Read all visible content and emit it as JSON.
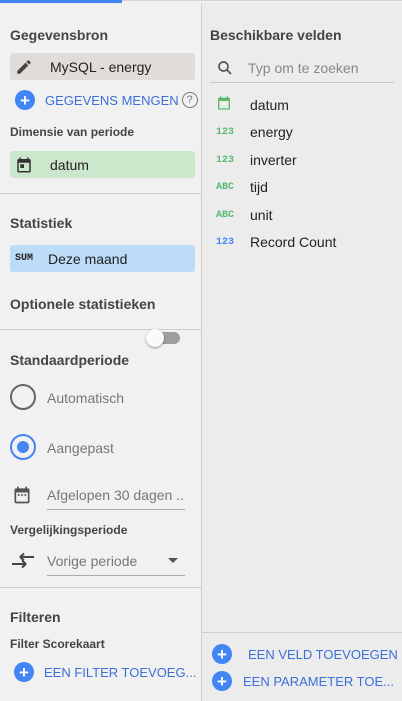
{
  "left": {
    "data_source_title": "Gegevensbron",
    "data_source_value": "MySQL - energy",
    "blend_label": "GEGEVENS MENGEN",
    "period_dimension_title": "Dimensie van periode",
    "period_dimension_value": "datum",
    "metrics_title": "Statistiek",
    "metric_agg": "SUM",
    "metric_value": "Deze maand",
    "optional_metrics_title": "Optionele statistieken",
    "optional_metrics_enabled": false,
    "default_period_title": "Standaardperiode",
    "radio_auto": "Automatisch",
    "radio_custom": "Aangepast",
    "selected_radio": "Aangepast",
    "date_range_value": "Afgelopen 30 dagen ...",
    "comparison_title": "Vergelijkingsperiode",
    "comparison_value": "Vorige periode",
    "filter_title": "Filteren",
    "filter_sub_title": "Filter Scorekaart",
    "add_filter_label": "EEN FILTER TOEVOEG..."
  },
  "right": {
    "fields_title": "Beschikbare velden",
    "search_placeholder": "Typ om te zoeken",
    "fields": [
      {
        "type": "date",
        "badge": "",
        "name": "datum",
        "color": "#5bb974"
      },
      {
        "type": "number",
        "badge": "123",
        "name": "energy",
        "color": "#5bb974"
      },
      {
        "type": "number",
        "badge": "123",
        "name": "inverter",
        "color": "#5bb974"
      },
      {
        "type": "text",
        "badge": "ABC",
        "name": "tijd",
        "color": "#5bb974"
      },
      {
        "type": "text",
        "badge": "ABC",
        "name": "unit",
        "color": "#5bb974"
      },
      {
        "type": "number",
        "badge": "123",
        "name": "Record Count",
        "color": "#4285f4"
      }
    ],
    "add_field_label": "EEN VELD TOEVOEGEN",
    "add_parameter_label": "EEN PARAMETER TOE..."
  },
  "colors": {
    "accent": "#4285f4",
    "dimension_green": "#5bb974",
    "source_chip": "#e2dcd8",
    "dimension_chip": "#cce8cc",
    "metric_chip": "#bcdcf7"
  }
}
